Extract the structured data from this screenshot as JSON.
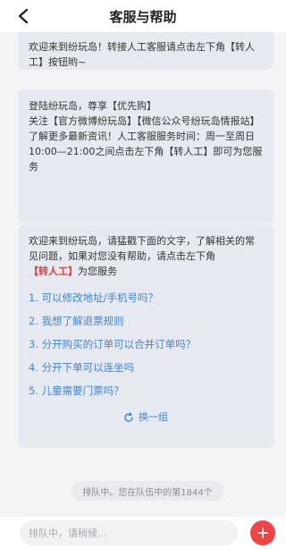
{
  "header": {
    "title": "客服与帮助"
  },
  "messages": {
    "welcome_short": "欢迎来到纷玩岛！转接人工客服请点击左下角【转人工】按钮哟~",
    "login": {
      "line1": "登陆纷玩岛，尊享【优先购】",
      "line2": "关注【官方微博纷玩岛】【微信公众号纷玩岛情报站】了解更多最新资讯！人工客服服务时间：周一至周日10:00—21:00之间点击左下角【转人工】即可为您服务"
    },
    "faq": {
      "intro_before": "欢迎来到纷玩岛，请猛戳下面的文字，了解相关的常见问题，如果对您没有帮助，请点击左下角",
      "intro_highlight": "【转人工】",
      "intro_after": "为您服务",
      "items": [
        "1. 可以修改地址/手机号吗？",
        "2. 我想了解退票规则",
        "3. 分开购买的订单可以合并订单吗？",
        "4. 分开下单可以连坐吗",
        "5. 儿童需要门票吗？"
      ],
      "refresh_label": "换一组"
    }
  },
  "queue": {
    "status": "排队中。您在队伍中的第1844个"
  },
  "composer": {
    "placeholder": "排队中，请稍候..."
  },
  "colors": {
    "accent_blue": "#3d86d6",
    "highlight_red": "#e23b3b",
    "add_button_red": "#f24444"
  }
}
